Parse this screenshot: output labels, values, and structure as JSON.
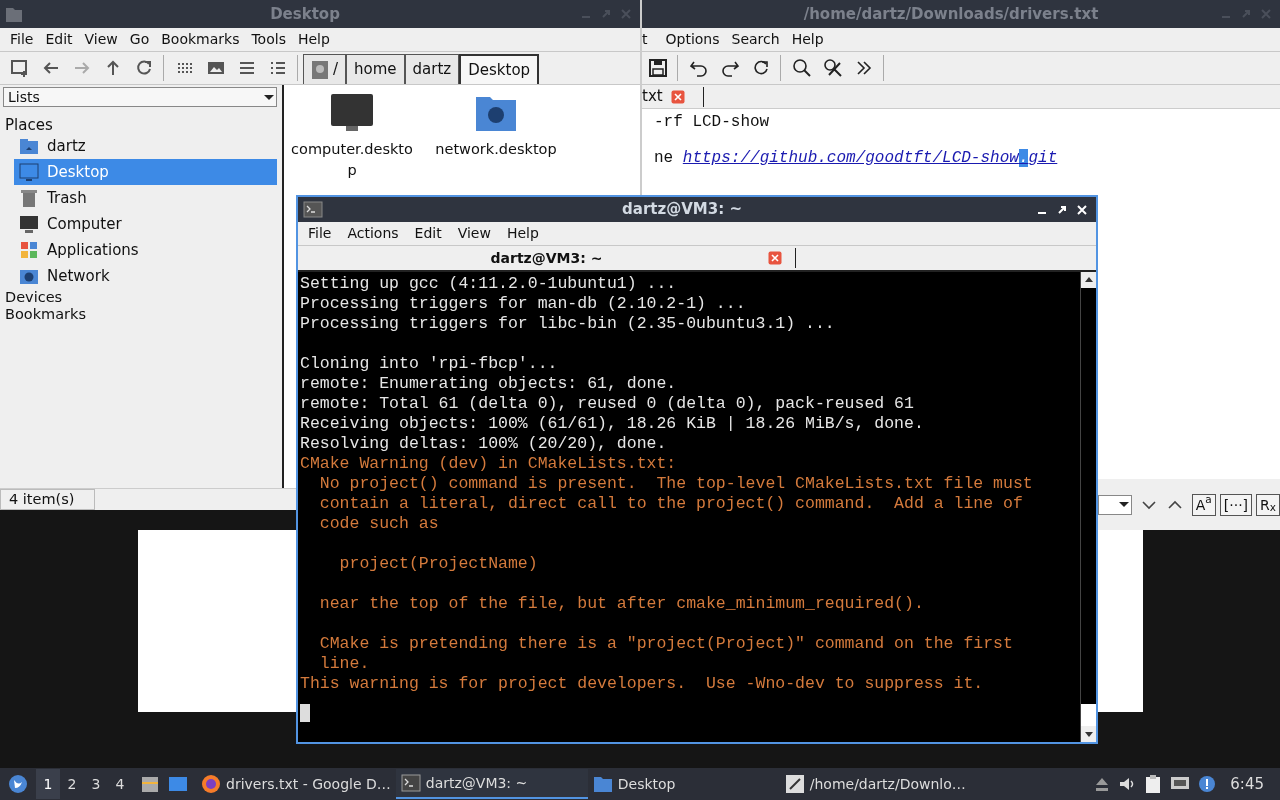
{
  "file_manager": {
    "title": "Desktop",
    "menu": [
      "File",
      "Edit",
      "View",
      "Go",
      "Bookmarks",
      "Tools",
      "Help"
    ],
    "path": [
      {
        "label": "/",
        "kind": "root",
        "selected": false
      },
      {
        "label": "home",
        "kind": "dir",
        "selected": false
      },
      {
        "label": "dartz",
        "kind": "dir",
        "selected": false
      },
      {
        "label": "Desktop",
        "kind": "dir",
        "selected": true
      }
    ],
    "side_pane_mode": "Lists",
    "places_heading": "Places",
    "places": [
      {
        "label": "dartz",
        "kind": "home",
        "selected": false
      },
      {
        "label": "Desktop",
        "kind": "desktop",
        "selected": true
      },
      {
        "label": "Trash",
        "kind": "trash",
        "selected": false
      },
      {
        "label": "Computer",
        "kind": "computer",
        "selected": false
      },
      {
        "label": "Applications",
        "kind": "applications",
        "selected": false
      },
      {
        "label": "Network",
        "kind": "network",
        "selected": false
      }
    ],
    "sections": [
      "Devices",
      "Bookmarks"
    ],
    "files": [
      {
        "name": "computer.desktop",
        "kind": "computer"
      },
      {
        "name": "network.desktop",
        "kind": "network"
      }
    ],
    "status": "4 item(s)"
  },
  "editor": {
    "title": "/home/dartz/Downloads/drivers.txt",
    "menu": [
      "t",
      "Options",
      "Search",
      "Help"
    ],
    "tab": "txt",
    "lines": [
      {
        "kind": "text",
        "text": "-rf LCD-show"
      },
      {
        "kind": "blank"
      },
      {
        "kind": "link",
        "text": "ne",
        "link": [
          {
            "text": "https://github.com/goodtft/LCD-show",
            "selected": false
          },
          {
            "text": ".",
            "selected": true
          },
          {
            "text": "git",
            "selected": false
          }
        ]
      }
    ],
    "search_buttons": [
      "A$^{a}$",
      "[···]",
      "R$_{x}$"
    ]
  },
  "terminal": {
    "title": "dartz@VM3: ~",
    "menu": [
      "File",
      "Actions",
      "Edit",
      "View",
      "Help"
    ],
    "tab": "dartz@VM3: ~",
    "lines": [
      {
        "kind": "normal",
        "text": "Setting up gcc (4:11.2.0-1ubuntu1) ..."
      },
      {
        "kind": "normal",
        "text": "Processing triggers for man-db (2.10.2-1) ..."
      },
      {
        "kind": "normal",
        "text": "Processing triggers for libc-bin (2.35-0ubuntu3.1) ..."
      },
      {
        "kind": "blank"
      },
      {
        "kind": "normal",
        "text": "Cloning into 'rpi-fbcp'..."
      },
      {
        "kind": "normal",
        "text": "remote: Enumerating objects: 61, done."
      },
      {
        "kind": "normal",
        "text": "remote: Total 61 (delta 0), reused 0 (delta 0), pack-reused 61"
      },
      {
        "kind": "normal",
        "text": "Receiving objects: 100% (61/61), 18.26 KiB | 18.26 MiB/s, done."
      },
      {
        "kind": "normal",
        "text": "Resolving deltas: 100% (20/20), done."
      },
      {
        "kind": "warning",
        "text": "CMake Warning (dev) in CMakeLists.txt:"
      },
      {
        "kind": "warning",
        "text": "  No project() command is present.  The top-level CMakeLists.txt file must"
      },
      {
        "kind": "warning",
        "text": "  contain a literal, direct call to the project() command.  Add a line of"
      },
      {
        "kind": "warning",
        "text": "  code such as"
      },
      {
        "kind": "blank"
      },
      {
        "kind": "warning",
        "text": "    project(ProjectName)"
      },
      {
        "kind": "blank"
      },
      {
        "kind": "warning",
        "text": "  near the top of the file, but after cmake_minimum_required()."
      },
      {
        "kind": "blank"
      },
      {
        "kind": "warning",
        "text": "  CMake is pretending there is a \"project(Project)\" command on the first"
      },
      {
        "kind": "warning",
        "text": "  line."
      },
      {
        "kind": "warning",
        "text": "This warning is for project developers.  Use -Wno-dev to suppress it."
      }
    ]
  },
  "taskbar": {
    "workspaces": [
      {
        "label": "1",
        "selected": true
      },
      {
        "label": "2",
        "selected": false
      },
      {
        "label": "3",
        "selected": false
      },
      {
        "label": "4",
        "selected": false
      }
    ],
    "tasks": [
      {
        "label": "drivers.txt - Google D…",
        "kind": "browser",
        "selected": false
      },
      {
        "label": "dartz@VM3: ~",
        "kind": "terminal",
        "selected": true
      },
      {
        "label": "Desktop",
        "kind": "folder",
        "selected": false
      },
      {
        "label": "/home/dartz/Downlo…",
        "kind": "editor",
        "selected": false
      }
    ],
    "clock": "6:45"
  }
}
